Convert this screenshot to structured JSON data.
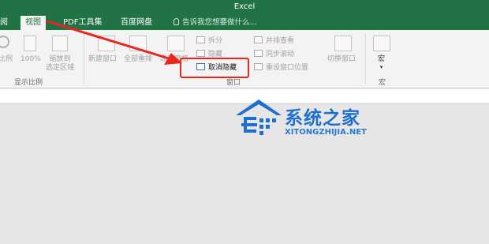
{
  "app": {
    "title": "Excel"
  },
  "tabs": [
    {
      "label": "阅"
    },
    {
      "label": "视图"
    },
    {
      "label": "PDF工具集"
    },
    {
      "label": "百度网盘"
    }
  ],
  "tell_me": {
    "placeholder": "告诉我您想要做什么..."
  },
  "ribbon": {
    "zoom_group": {
      "zoom_label": "比例",
      "zoom_100": "100%",
      "zoom_selection_line1": "缩放到",
      "zoom_selection_line2": "选定区域",
      "group_label": "显示比例"
    },
    "window_group": {
      "new_window": "新建窗口",
      "arrange_all": "全部重排",
      "freeze_panes": "冻结窗格",
      "split": "拆分",
      "hide": "隐藏",
      "unhide": "取消隐藏",
      "view_side_by_side": "并排查看",
      "synchronous_scrolling": "同步滚动",
      "reset_window_position": "重设窗口位置",
      "switch_windows": "切换窗口",
      "group_label": "窗口"
    },
    "macros_group": {
      "macros": "宏",
      "group_label": "宏"
    }
  },
  "watermark": {
    "cn_text": "系统之家",
    "en_text": "XITONGZHIJIA.NET"
  },
  "colors": {
    "excel_green": "#217346",
    "annotation_red": "#e8271c",
    "watermark_blue": "#1f6fd1"
  }
}
